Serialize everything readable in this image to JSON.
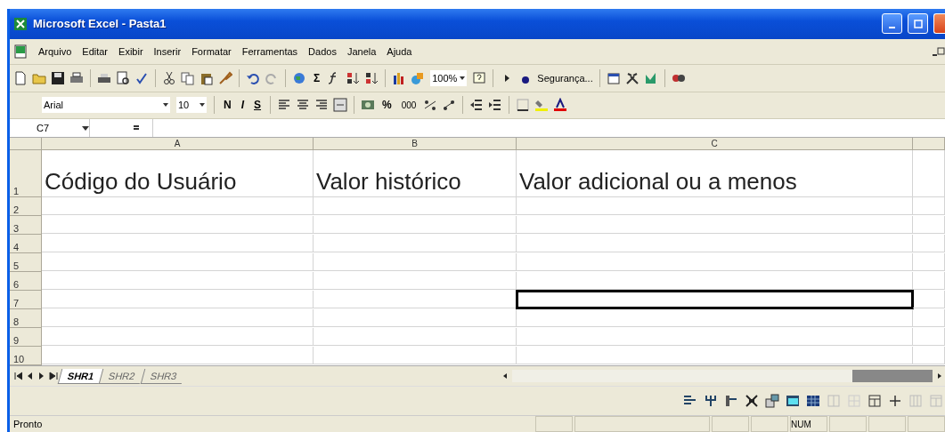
{
  "window": {
    "title": "Microsoft Excel - Pasta1"
  },
  "menu": [
    "Arquivo",
    "Editar",
    "Exibir",
    "Inserir",
    "Formatar",
    "Ferramentas",
    "Dados",
    "Janela",
    "Ajuda"
  ],
  "standard_toolbar": {
    "sum": "Σ",
    "zoom": "100%",
    "security": "Segurança..."
  },
  "format_toolbar": {
    "font": "Arial",
    "size": "10",
    "bold": "N",
    "italic": "I",
    "underline": "S",
    "percent": "%",
    "thousands": "000"
  },
  "formula_bar": {
    "name_box": "C7"
  },
  "sheet": {
    "columns": [
      "A",
      "B",
      "C"
    ],
    "rows": [
      {
        "header": "1",
        "cells": [
          {
            "text": "Código do Usuário",
            "selected": false
          },
          {
            "text": "Valor histórico",
            "selected": false
          },
          {
            "text": "Valor adicional ou a menos",
            "selected": false
          }
        ]
      },
      {
        "header": "2",
        "cells": [
          {
            "selected": false
          },
          {
            "selected": false
          },
          {
            "selected": false
          }
        ]
      },
      {
        "header": "3",
        "cells": [
          {
            "selected": false
          },
          {
            "selected": false
          },
          {
            "selected": false
          }
        ]
      },
      {
        "header": "4",
        "cells": [
          {
            "selected": false
          },
          {
            "selected": false
          },
          {
            "selected": false
          }
        ]
      },
      {
        "header": "5",
        "cells": [
          {
            "selected": false
          },
          {
            "selected": false
          },
          {
            "selected": false
          }
        ]
      },
      {
        "header": "6",
        "cells": [
          {
            "selected": false
          },
          {
            "selected": false
          },
          {
            "selected": false
          }
        ]
      },
      {
        "header": "7",
        "cells": [
          {
            "selected": false
          },
          {
            "selected": false
          },
          {
            "selected": true
          }
        ]
      },
      {
        "header": "8",
        "cells": [
          {
            "selected": false
          },
          {
            "selected": false
          },
          {
            "selected": false
          }
        ]
      },
      {
        "header": "9",
        "cells": [
          {
            "selected": false
          },
          {
            "selected": false
          },
          {
            "selected": false
          }
        ]
      },
      {
        "header": "10",
        "cells": [
          {
            "selected": false
          },
          {
            "selected": false
          },
          {
            "selected": false
          }
        ]
      }
    ]
  },
  "sheet_tabs": [
    {
      "label": "SHR1",
      "selected": true
    },
    {
      "label": "SHR2",
      "selected": false
    },
    {
      "label": "SHR3",
      "selected": false
    }
  ],
  "status_bar": {
    "text": "Pronto",
    "num": "NUM"
  }
}
